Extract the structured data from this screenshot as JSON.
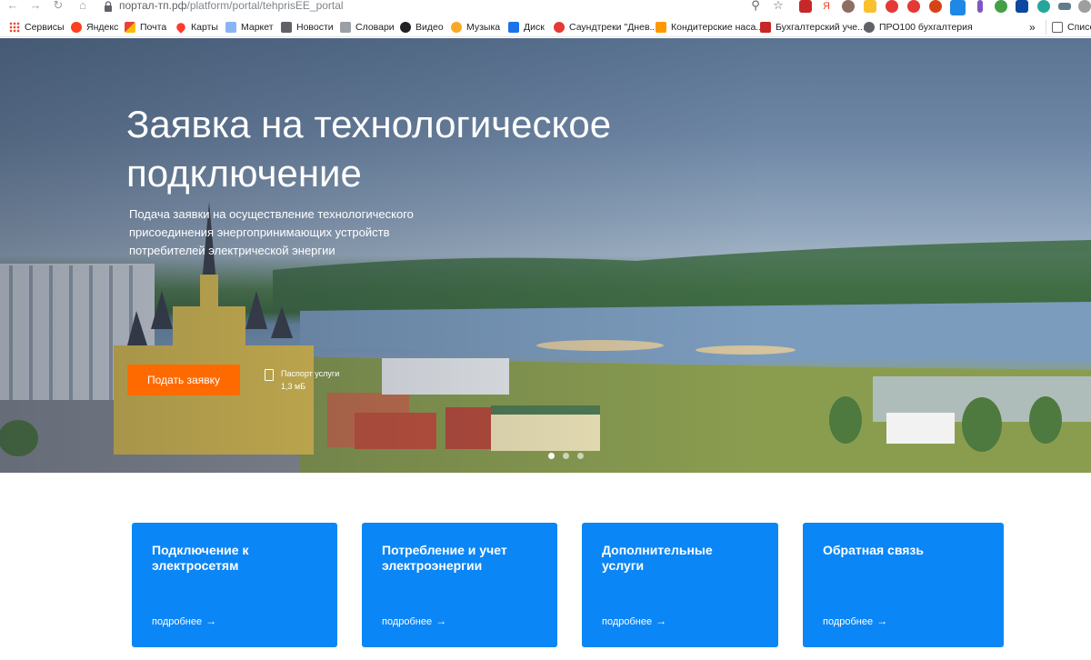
{
  "browser": {
    "url_host": "портал-тп.рф",
    "url_path": "/platform/portal/tehprisEE_portal",
    "bookmarks": [
      {
        "label": "Сервисы",
        "icon": "apps-grid-icon",
        "color": "#e8453c"
      },
      {
        "label": "Яндекс",
        "icon": "yandex-icon",
        "color": "#fc3f1d"
      },
      {
        "label": "Почта",
        "icon": "mail-icon",
        "color": "#ea4335"
      },
      {
        "label": "Карты",
        "icon": "map-pin-icon",
        "color": "#ff3b30"
      },
      {
        "label": "Маркет",
        "icon": "market-icon",
        "color": "#8ab4f8"
      },
      {
        "label": "Новости",
        "icon": "news-icon",
        "color": "#5f6368"
      },
      {
        "label": "Словари",
        "icon": "dictionary-icon",
        "color": "#9aa0a6"
      },
      {
        "label": "Видео",
        "icon": "video-icon",
        "color": "#202124"
      },
      {
        "label": "Музыка",
        "icon": "music-icon",
        "color": "#f9a825"
      },
      {
        "label": "Диск",
        "icon": "disk-icon",
        "color": "#1a73e8"
      },
      {
        "label": "Саундтреки \"Днев...",
        "icon": "soundtrack-icon",
        "color": "#e53935"
      },
      {
        "label": "Кондитерские наса...",
        "icon": "bookmark-orange-icon",
        "color": "#ff9800"
      },
      {
        "label": "Бухгалтерский уче...",
        "icon": "accounting-icon",
        "color": "#c62828"
      },
      {
        "label": "ПРО100 бухгалтерия",
        "icon": "globe-icon",
        "color": "#5f6368"
      }
    ],
    "overflow_label": "»",
    "reading_list_label": "Список"
  },
  "hero": {
    "title_line1": "Заявка на технологическое",
    "title_line2": "подключение",
    "subtitle": "Подача заявки на осуществление технологического присоединения энергопринимающих устройств потребителей электрической энергии",
    "cta_label": "Подать заявку",
    "passport_name": "Паспорт услуги",
    "passport_size": "1,3 мБ",
    "slides_total": 3,
    "slide_active": 1
  },
  "cards": [
    {
      "title": "Подключение к электросетям",
      "more": "подробнее"
    },
    {
      "title": "Потребление и учет электроэнергии",
      "more": "подробнее"
    },
    {
      "title": "Дополнительные услуги",
      "more": "подробнее"
    },
    {
      "title": "Обратная связь",
      "more": "подробнее"
    }
  ],
  "colors": {
    "accent_orange": "#ff6a00",
    "card_blue": "#0b86f6"
  }
}
